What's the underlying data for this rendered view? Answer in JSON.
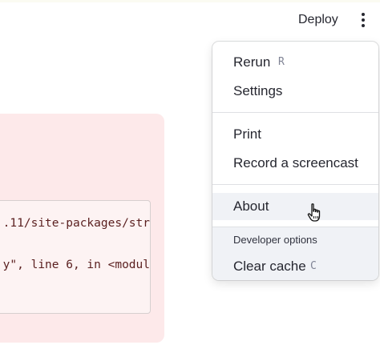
{
  "header": {
    "deploy_label": "Deploy"
  },
  "error": {
    "code_lines": [
      ".11/site-packages/str",
      "y\", line 6, in <modul"
    ]
  },
  "menu": {
    "rerun": {
      "label": "Rerun",
      "shortcut": "R"
    },
    "settings": {
      "label": "Settings"
    },
    "print": {
      "label": "Print"
    },
    "record": {
      "label": "Record a screencast"
    },
    "about": {
      "label": "About"
    },
    "developer_options_label": "Developer options",
    "clear_cache": {
      "label": "Clear cache",
      "shortcut": "C"
    }
  },
  "colors": {
    "text": "#262730",
    "error_bg": "#fde9ea",
    "menu_highlight": "#f0f2f6"
  },
  "icons": {
    "menu_button": "kebab-menu-icon",
    "cursor": "hand-pointer-icon"
  }
}
